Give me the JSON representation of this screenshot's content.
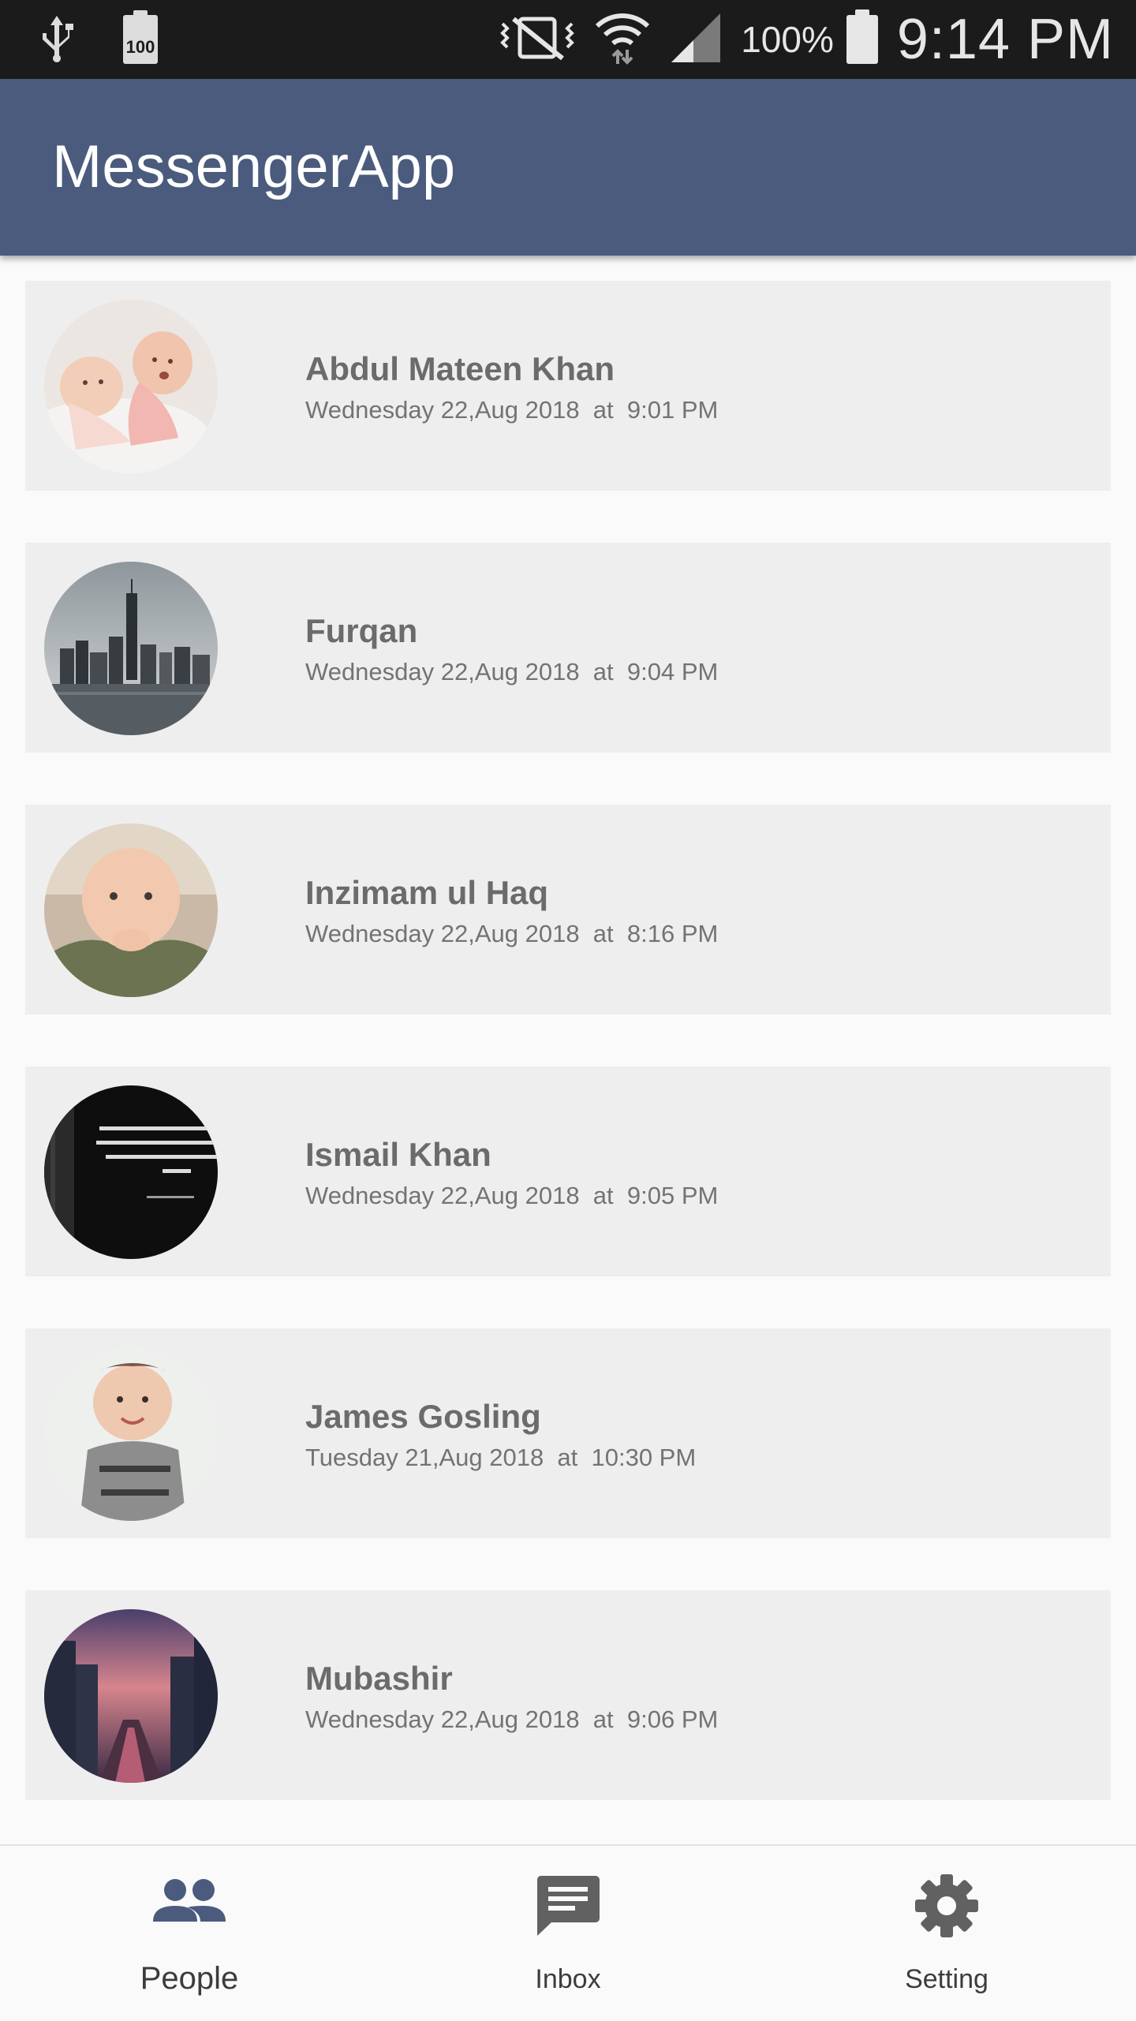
{
  "status_bar": {
    "battery_small_label": "100",
    "battery_percent": "100%",
    "time": "9:14 PM",
    "icons": [
      "usb-icon",
      "battery-saver-icon",
      "vibrate-mute-icon",
      "wifi-icon",
      "cell-signal-icon",
      "battery-icon"
    ]
  },
  "app_bar": {
    "title": "MessengerApp",
    "color": "#4b5b7e"
  },
  "conversations": [
    {
      "name": "Abdul Mateen Khan",
      "timestamp": "Wednesday 22,Aug 2018  at  9:01 PM",
      "avatar": "baby-photo"
    },
    {
      "name": "Furqan",
      "timestamp": "Wednesday 22,Aug 2018  at  9:04 PM",
      "avatar": "city-skyline-photo"
    },
    {
      "name": "Inzimam ul Haq",
      "timestamp": "Wednesday 22,Aug 2018  at  8:16 PM",
      "avatar": "baby-photo"
    },
    {
      "name": "Ismail Khan",
      "timestamp": "Wednesday 22,Aug 2018  at  9:05 PM",
      "avatar": "quote-photo"
    },
    {
      "name": "James Gosling",
      "timestamp": "Tuesday 21,Aug 2018  at  10:30 PM",
      "avatar": "baby-photo"
    },
    {
      "name": "Mubashir",
      "timestamp": "Wednesday 22,Aug 2018  at  9:06 PM",
      "avatar": "city-night-photo"
    }
  ],
  "bottom_nav": {
    "items": [
      {
        "label": "People",
        "icon": "people-icon",
        "active": true
      },
      {
        "label": "Inbox",
        "icon": "message-icon",
        "active": false
      },
      {
        "label": "Setting",
        "icon": "gear-icon",
        "active": false
      }
    ],
    "active_color": "#4b5b7e",
    "inactive_color": "#616161"
  }
}
